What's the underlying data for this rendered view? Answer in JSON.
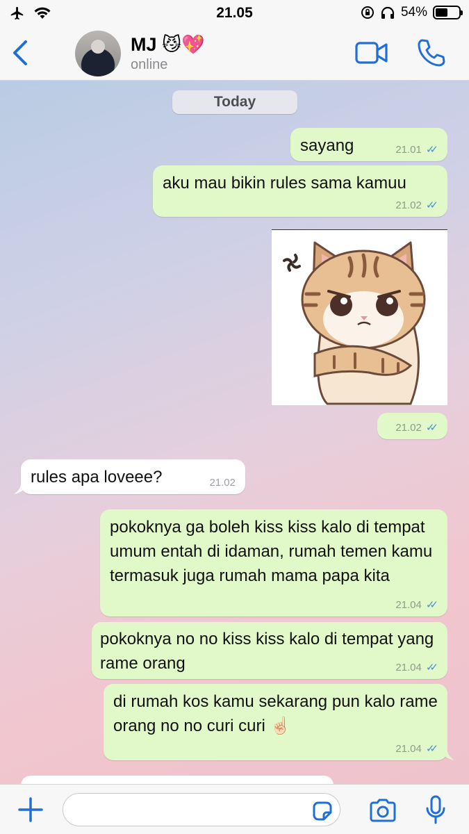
{
  "status_bar": {
    "time": "21.05",
    "battery_text": "54%",
    "battery_level": 0.54
  },
  "header": {
    "contact_name": "MJ 😼💖",
    "contact_status": "online"
  },
  "chat": {
    "date_label": "Today",
    "messages": [
      {
        "direction": "out",
        "text": "sayang",
        "time": "21.01"
      },
      {
        "direction": "out",
        "text": "aku mau bikin rules sama kamuu",
        "time": "21.02"
      },
      {
        "direction": "out",
        "type": "sticker",
        "text": "",
        "time": "21.02"
      },
      {
        "direction": "in",
        "text": "rules apa loveee?",
        "time": "21.02"
      },
      {
        "direction": "out",
        "text": "pokoknya ga boleh kiss kiss kalo di tempat umum entah di idaman, rumah temen kamu termasuk juga rumah mama papa kita",
        "time": "21.04"
      },
      {
        "direction": "out",
        "text": "pokoknya no no kiss kiss kalo di tempat yang rame orang",
        "time": "21.04"
      },
      {
        "direction": "out",
        "text": "di rumah kos kamu sekarang pun kalo rame orang no no curi curi ☝🏻",
        "time": "21.04"
      }
    ]
  },
  "input": {
    "value": "",
    "placeholder": ""
  },
  "colors": {
    "accent": "#1f6fd6",
    "outgoing_bubble": "#e1f8c9",
    "incoming_bubble": "#ffffff",
    "read_ticks": "#4a8fd6"
  },
  "icons": [
    "back-icon",
    "video-call-icon",
    "phone-call-icon",
    "plus-icon",
    "sticker-icon",
    "camera-icon",
    "microphone-icon",
    "airplane-icon",
    "wifi-icon",
    "orientation-lock-icon",
    "headphones-icon",
    "battery-icon"
  ]
}
